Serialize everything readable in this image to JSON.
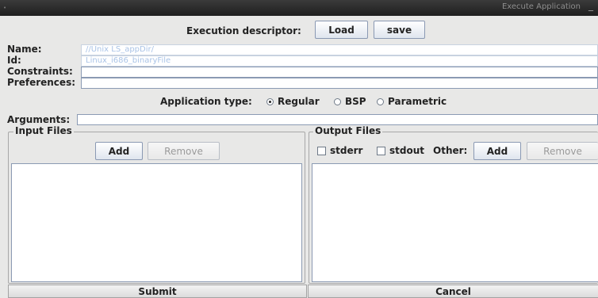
{
  "window": {
    "title": "Execute Application",
    "minimize_glyph": "_",
    "menu_glyph": "•"
  },
  "descriptor": {
    "label": "Execution descriptor:",
    "load_label": "Load",
    "save_label": "save"
  },
  "fields": {
    "name_label": "Name:",
    "name_value": "//Unix LS_appDir/",
    "id_label": "Id:",
    "id_value": "Linux_i686_binaryFile",
    "constraints_label": "Constraints:",
    "constraints_value": "",
    "preferences_label": "Preferences:",
    "preferences_value": ""
  },
  "app_type": {
    "label": "Application type:",
    "options": [
      "Regular",
      "BSP",
      "Parametric"
    ],
    "selected": "Regular"
  },
  "arguments": {
    "label": "Arguments:",
    "value": ""
  },
  "input_files": {
    "title": "Input Files",
    "add_label": "Add",
    "remove_label": "Remove"
  },
  "output_files": {
    "title": "Output Files",
    "stderr_label": "stderr",
    "stdout_label": "stdout",
    "other_label": "Other:",
    "add_label": "Add",
    "remove_label": "Remove"
  },
  "footer": {
    "submit_label": "Submit",
    "cancel_label": "Cancel"
  }
}
